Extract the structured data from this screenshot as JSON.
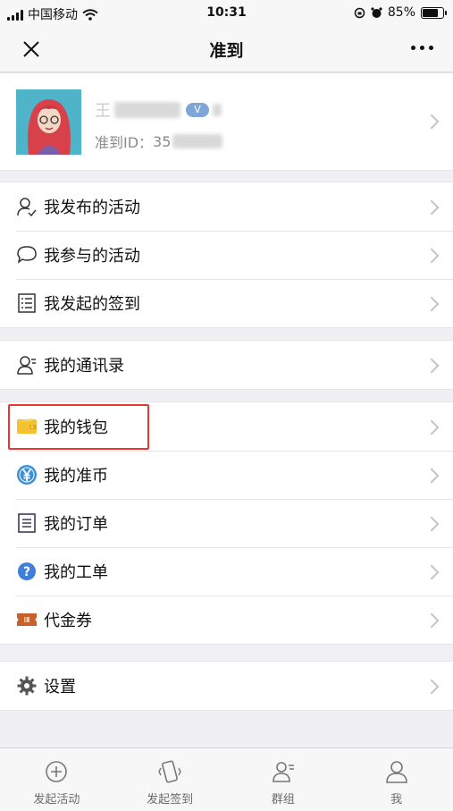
{
  "status": {
    "carrier": "中国移动",
    "time": "10:31",
    "battery_level": 85,
    "battery_text": "85%"
  },
  "nav": {
    "title": "准到"
  },
  "profile": {
    "name_visible": "王",
    "id_label": "准到ID：",
    "id_visible": "35"
  },
  "groups": [
    {
      "items": [
        {
          "label": "我发布的活动",
          "icon": "user-check-icon"
        },
        {
          "label": "我参与的活动",
          "icon": "chat-bubble-icon"
        },
        {
          "label": "我发起的签到",
          "icon": "checklist-icon"
        }
      ]
    },
    {
      "items": [
        {
          "label": "我的通讯录",
          "icon": "contacts-icon"
        }
      ]
    },
    {
      "items": [
        {
          "label": "我的钱包",
          "icon": "wallet-icon"
        },
        {
          "label": "我的准币",
          "icon": "yen-coin-icon"
        },
        {
          "label": "我的订单",
          "icon": "order-list-icon"
        },
        {
          "label": "我的工单",
          "icon": "question-icon"
        },
        {
          "label": "代金券",
          "icon": "coupon-icon"
        }
      ]
    },
    {
      "items": [
        {
          "label": "设置",
          "icon": "gear-icon"
        }
      ]
    }
  ],
  "tabs": [
    {
      "label": "发起活动",
      "icon": "plus-circle-icon"
    },
    {
      "label": "发起签到",
      "icon": "phone-shake-icon"
    },
    {
      "label": "群组",
      "icon": "group-icon"
    },
    {
      "label": "我",
      "icon": "person-icon"
    }
  ],
  "colors": {
    "highlight": "#e53935",
    "wallet": "#f2c230",
    "coin": "#3a8fd8",
    "help": "#3f7fd9",
    "coupon": "#c8602c"
  }
}
